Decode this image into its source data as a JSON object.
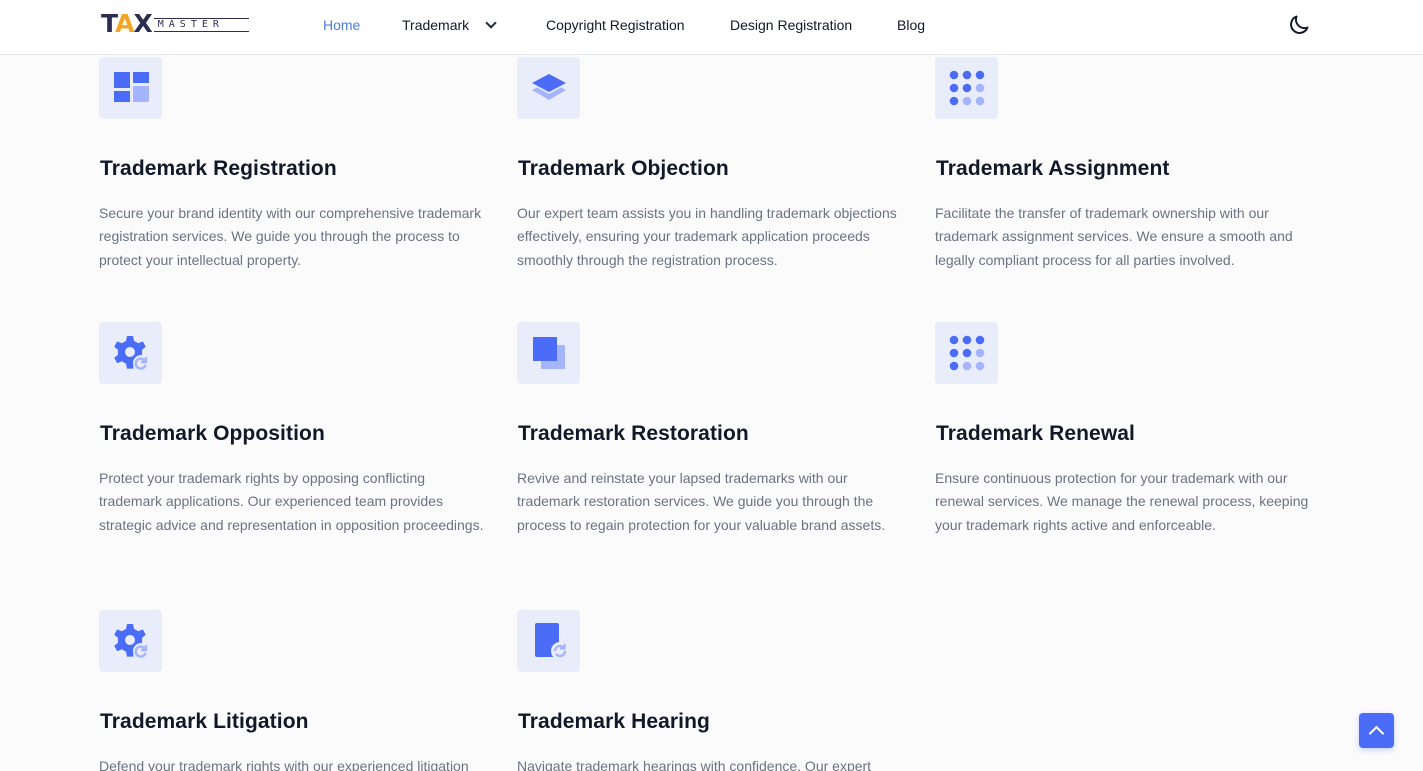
{
  "brand": {
    "logo_main": "TAX",
    "logo_sub": "MASTER"
  },
  "nav": {
    "home": "Home",
    "trademark": "Trademark",
    "copyright": "Copyright Registration",
    "design": "Design Registration",
    "blog": "Blog"
  },
  "colors": {
    "accent": "#4a6cf7",
    "nav_active": "#4a7fe0",
    "icon_bg": "#e9ecfb",
    "icon_light": "#a5b4fc"
  },
  "services": [
    {
      "icon": "dashboard-icon",
      "title": "Trademark Registration",
      "desc": "Secure your brand identity with our comprehensive trademark registration services. We guide you through the process to protect your intellectual property."
    },
    {
      "icon": "layers-icon",
      "title": "Trademark Objection",
      "desc": "Our expert team assists you in handling trademark objections effectively, ensuring your trademark application proceeds smoothly through the registration process."
    },
    {
      "icon": "grid-dots-icon",
      "title": "Trademark Assignment",
      "desc": "Facilitate the transfer of trademark ownership with our trademark assignment services. We ensure a smooth and legally compliant process for all parties involved."
    },
    {
      "icon": "gear-refresh-icon",
      "title": "Trademark Opposition",
      "desc": "Protect your trademark rights by opposing conflicting trademark applications. Our experienced team provides strategic advice and representation in opposition proceedings."
    },
    {
      "icon": "duplicate-icon",
      "title": "Trademark Restoration",
      "desc": "Revive and reinstate your lapsed trademarks with our trademark restoration services. We guide you through the process to regain protection for your valuable brand assets."
    },
    {
      "icon": "grid-dots-icon",
      "title": "Trademark Renewal",
      "desc": "Ensure continuous protection for your trademark with our renewal services. We manage the renewal process, keeping your trademark rights active and enforceable."
    },
    {
      "icon": "gear-refresh-icon",
      "title": "Trademark Litigation",
      "desc": "Defend your trademark rights with our experienced litigation"
    },
    {
      "icon": "file-refresh-icon",
      "title": "Trademark Hearing",
      "desc": "Navigate trademark hearings with confidence. Our expert"
    }
  ]
}
